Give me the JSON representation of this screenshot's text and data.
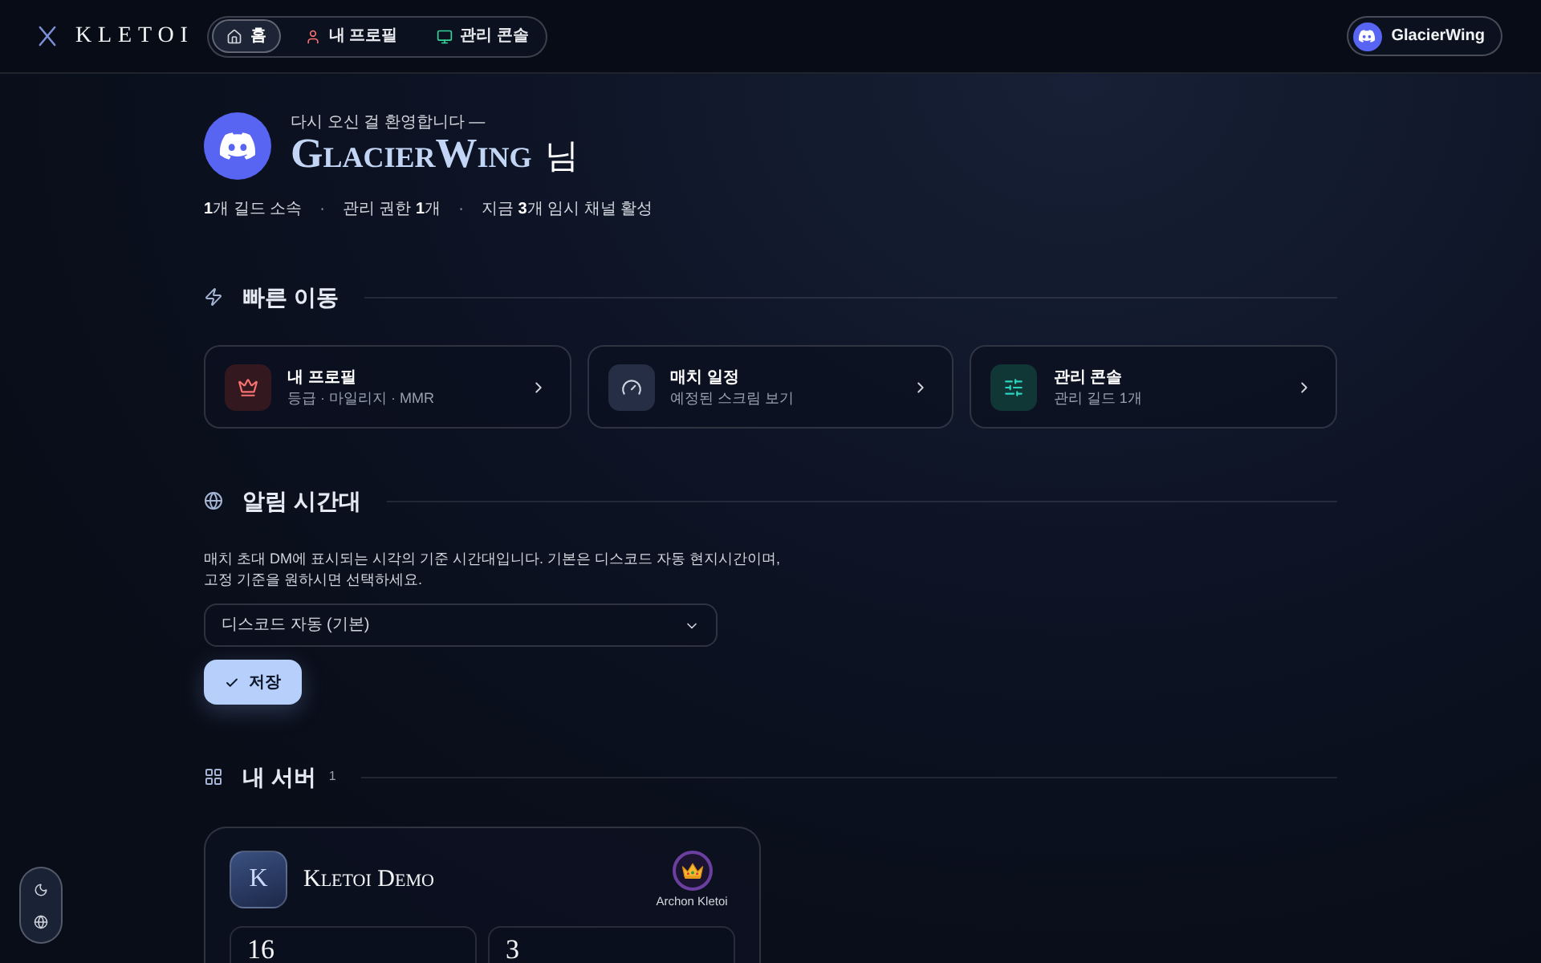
{
  "header": {
    "logo": "KLETOI",
    "nav": [
      {
        "label": "홈",
        "selected": true
      },
      {
        "label": "내 프로필",
        "selected": false
      },
      {
        "label": "관리 콘솔",
        "selected": false
      }
    ],
    "user_button": "GlacierWing"
  },
  "hero": {
    "greeting": "다시 오신 걸 환영합니다 —",
    "name": "GlacierWing",
    "suffix": "님",
    "stats": [
      "**1**개 길드 소속",
      "관리 권한 **1**개",
      "지금 **3**개 임시 채널 활성"
    ],
    "separator": "·"
  },
  "quick_links": {
    "title": "빠른 이동",
    "cards": [
      {
        "title": "내 프로필",
        "subtitle": "등급 · 마일리지 · MMR"
      },
      {
        "title": "매치 일정",
        "subtitle": "예정된 스크림 보기"
      },
      {
        "title": "관리 콘솔",
        "subtitle": "관리 길드 1개"
      }
    ]
  },
  "timezone": {
    "title": "알림 시간대",
    "description": "매치 초대 DM에 표시되는 시각의 기준 시간대입니다. 기본은 디스코드 자동 현지시간이며, 고정 기준을 원하시면 선택하세요.",
    "select_value": "디스코드 자동 (기본)",
    "save_button": "저장"
  },
  "servers": {
    "title": "내 서버",
    "count": "1",
    "items": [
      {
        "initial": "K",
        "name": "Kletoi Demo",
        "role": "Archon Kletoi",
        "stats": [
          "16",
          "3"
        ]
      }
    ]
  }
}
